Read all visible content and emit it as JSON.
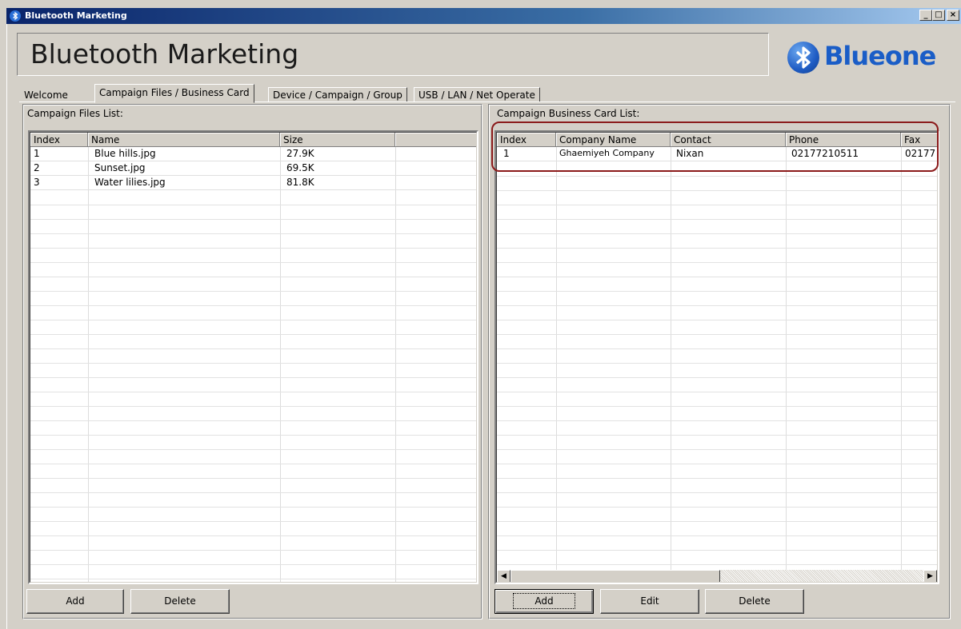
{
  "window": {
    "title": "Bluetooth Marketing",
    "minimize": "_",
    "maximize": "□",
    "close": "×"
  },
  "header": {
    "app_title": "Bluetooth Marketing",
    "logo_text": "Blueone",
    "logo_icon": "bluetooth-icon"
  },
  "tabs": [
    {
      "label": "Welcome"
    },
    {
      "label": "Campaign Files / Business Card"
    },
    {
      "label": "Device / Campaign / Group"
    },
    {
      "label": "USB / LAN / Net Operate"
    }
  ],
  "files_panel": {
    "label": "Campaign Files List:",
    "columns": [
      "Index",
      "Name",
      "Size",
      ""
    ],
    "rows": [
      {
        "index": "1",
        "name": "Blue hills.jpg",
        "size": "27.9K"
      },
      {
        "index": "2",
        "name": "Sunset.jpg",
        "size": "69.5K"
      },
      {
        "index": "3",
        "name": "Water lilies.jpg",
        "size": "81.8K"
      }
    ],
    "add_label": "Add",
    "delete_label": "Delete"
  },
  "cards_panel": {
    "label": "Campaign Business Card List:",
    "columns": [
      "Index",
      "Company Name",
      "Contact",
      "Phone",
      "Fax"
    ],
    "rows": [
      {
        "index": "1",
        "company": "Ghaemiyeh Company",
        "contact": "Nixan",
        "phone": "02177210511",
        "fax": "02177"
      }
    ],
    "add_label": "Add",
    "edit_label": "Edit",
    "delete_label": "Delete"
  },
  "colors": {
    "title_gradient_start": "#0a246a",
    "logo_blue": "#1a5dc7",
    "highlight_border": "#8b1a1a"
  }
}
